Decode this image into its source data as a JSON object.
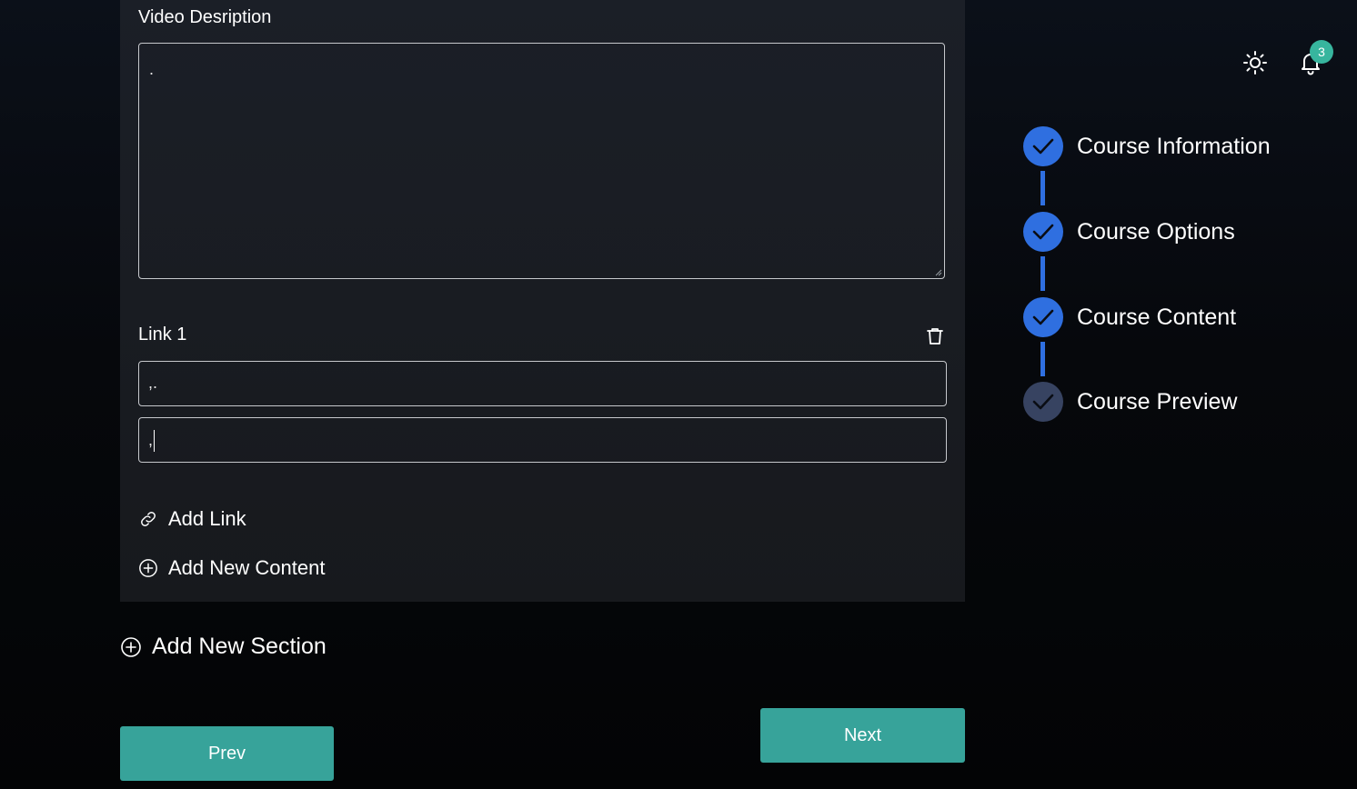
{
  "content_card": {
    "description_label": "Video Desription",
    "description_value": ".",
    "link_label": "Link 1",
    "link_title_value": ",.",
    "link_url_value": ",",
    "add_link_label": "Add Link",
    "add_content_label": "Add New Content"
  },
  "add_section_label": "Add New Section",
  "buttons": {
    "prev": "Prev",
    "next": "Next"
  },
  "header": {
    "theme_icon": "sun-icon",
    "notification_icon": "bell-icon",
    "notification_count": "3"
  },
  "stepper": {
    "steps": [
      {
        "label": "Course Information",
        "status": "completed"
      },
      {
        "label": "Course Options",
        "status": "completed"
      },
      {
        "label": "Course Content",
        "status": "completed"
      },
      {
        "label": "Course Preview",
        "status": "pending"
      }
    ]
  },
  "colors": {
    "accent_teal": "#37a39a",
    "step_active": "#2f6fe0",
    "step_pending": "#374361",
    "badge": "#37b59e"
  }
}
